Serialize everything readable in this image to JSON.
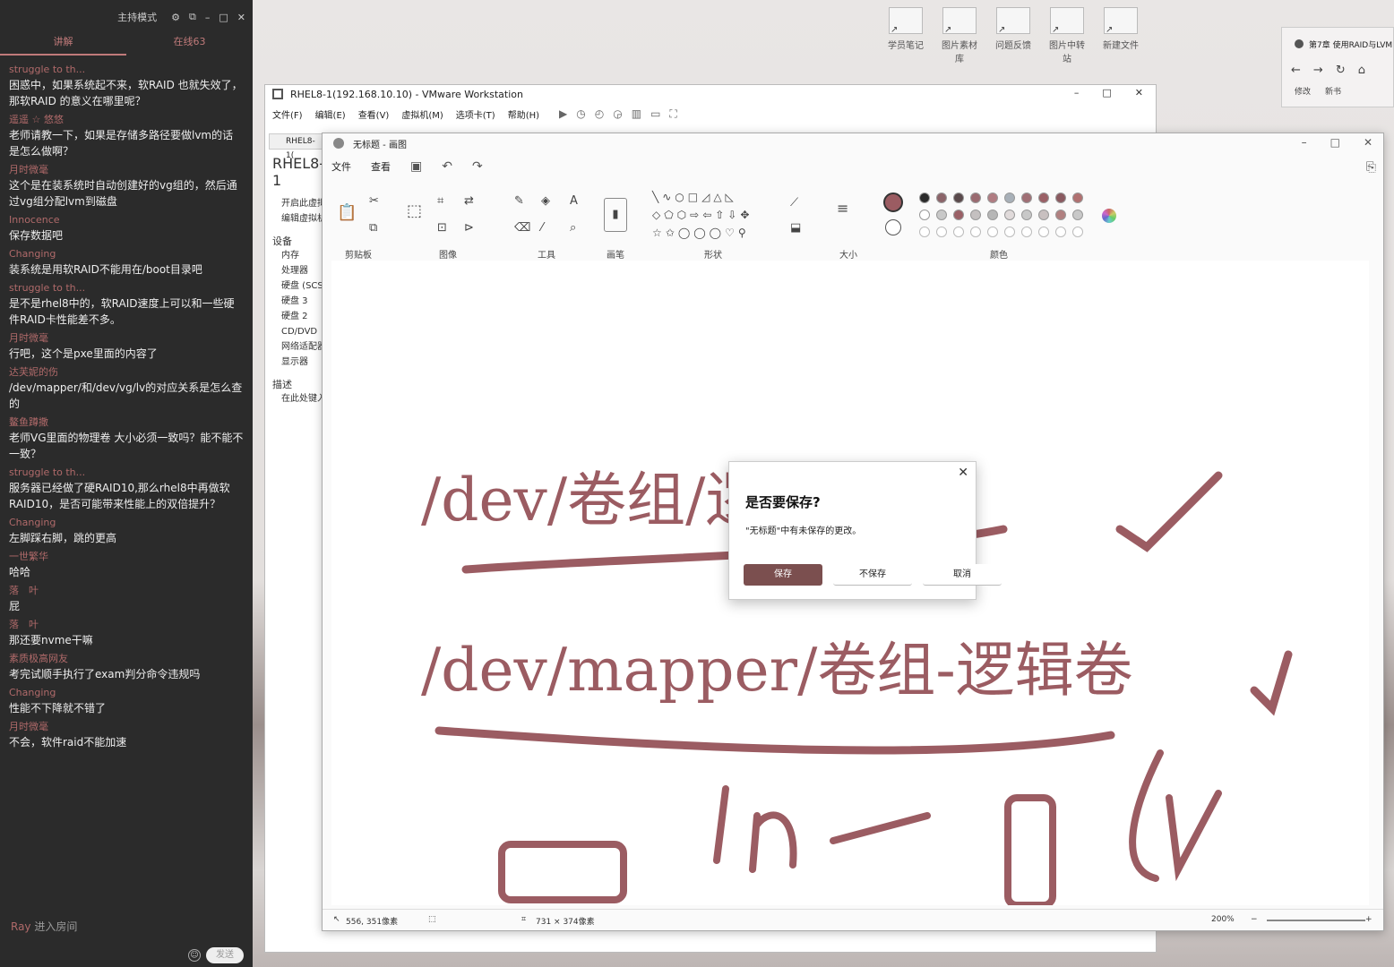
{
  "chat": {
    "mode": "主持模式",
    "tabs": [
      "讲解",
      "在线63"
    ],
    "messages": [
      {
        "user": "struggle to th...",
        "text": "困惑中，如果系统起不来，软RAID 也就失效了，那软RAID 的意义在哪里呢？"
      },
      {
        "user": "遥遥 ☆ 悠悠",
        "text": "老师请教一下，如果是存储多路径要做lvm的话是怎么做啊？"
      },
      {
        "user": "月时微毫",
        "text": "这个是在装系统时自动创建好的vg组的，然后通过vg组分配lvm到磁盘"
      },
      {
        "user": "Innocence",
        "text": "保存数据吧"
      },
      {
        "user": "Changing",
        "text": "装系统是用软RAID不能用在/boot目录吧"
      },
      {
        "user": "struggle to th...",
        "text": "是不是rhel8中的，软RAID速度上可以和一些硬件RAID卡性能差不多。"
      },
      {
        "user": "月时微毫",
        "text": "行吧，这个是pxe里面的内容了"
      },
      {
        "user": "达芙妮的伤",
        "text": "/dev/mapper/和/dev/vg/lv的对应关系是怎么查的"
      },
      {
        "user": "鳌鱼蹲撒",
        "text": "老师VG里面的物理卷 大小必须一致吗？能不能不一致？"
      },
      {
        "user": "struggle to th...",
        "text": "服务器已经做了硬RAID10,那么rhel8中再做软RAID10，是否可能带来性能上的双倍提升？"
      },
      {
        "user": "Changing",
        "text": "左脚踩右脚，跳的更高"
      },
      {
        "user": "一世繁华",
        "text": "哈哈"
      },
      {
        "user": "落　叶",
        "text": "屁"
      },
      {
        "user": "落　叶",
        "text": "那还要nvme干嘛"
      },
      {
        "user": "素质极高网友",
        "text": "考完试顺手执行了exam判分命令违规吗"
      },
      {
        "user": "Changing",
        "text": "性能不下降就不错了"
      },
      {
        "user": "月时微毫",
        "text": "不会，软件raid不能加速"
      }
    ],
    "joined_user": "Ray",
    "joined_text": "进入房间",
    "send_label": "发送"
  },
  "desktop": {
    "icons": [
      "学员笔记",
      "图片素材库",
      "问题反馈",
      "图片中转站",
      "新建文件"
    ]
  },
  "vmware": {
    "title": "RHEL8-1(192.168.10.10) - VMware Workstation",
    "menu": [
      "文件(F)",
      "编辑(E)",
      "查看(V)",
      "虚拟机(M)",
      "选项卡(T)",
      "帮助(H)"
    ],
    "tab": "RHEL8-1(",
    "vm_name": "RHEL8-1",
    "actions": [
      "开启此虚拟机",
      "编辑虚拟机设置"
    ],
    "devices_header": "设备",
    "devices": [
      "内存",
      "处理器",
      "硬盘 (SCSI)",
      "硬盘 3",
      "硬盘 2",
      "CD/DVD",
      "网络适配器",
      "显示器"
    ],
    "desc_header": "描述",
    "desc_placeholder": "在此处键入"
  },
  "paint": {
    "title": "无标题 - 画图",
    "menu": [
      "文件",
      "查看"
    ],
    "groups": [
      "剪贴板",
      "图像",
      "工具",
      "画笔",
      "形状",
      "大小",
      "颜色"
    ],
    "canvas_text": [
      "/dev/卷组/逻辑卷",
      "/dev/mapper/卷组-逻辑卷"
    ],
    "status": {
      "cursor": "556, 351像素",
      "size": "731 × 374像素",
      "zoom": "200%"
    },
    "colors": {
      "primary": "#9b5c62",
      "palette_row1": [
        "#2a2a2a",
        "#8b6469",
        "#5a4a4c",
        "#9a6a70",
        "#b07c82",
        "#a8b0b8",
        "#a06f75",
        "#9a6066",
        "#8a5a60",
        "#b07070"
      ],
      "palette_row2": [
        "#ffffff",
        "#c8c8c8",
        "#9a6066",
        "#c4c0c0",
        "#b6b6b6",
        "#e0dada",
        "#c8c8c8",
        "#c8c0c0",
        "#b08080",
        "#c8c8c8"
      ]
    }
  },
  "dialog": {
    "title": "是否要保存?",
    "message": "\"无标题\"中有未保存的更改。",
    "save": "保存",
    "dont_save": "不保存",
    "cancel": "取消"
  },
  "browser": {
    "tab_title": "第7章 使用RAID与LVM",
    "bookmarks": [
      "修改",
      "新书"
    ]
  }
}
